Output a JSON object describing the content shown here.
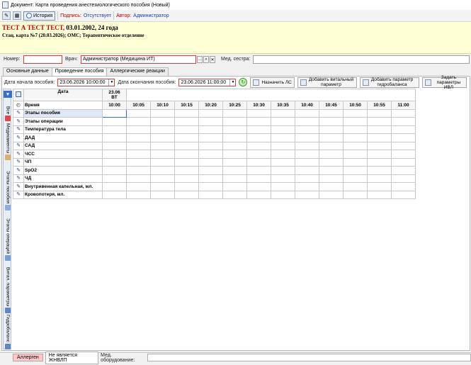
{
  "window": {
    "title": "Документ: Карта проведения анестезиологического пособия (Новый)"
  },
  "toolbar": {
    "history_label": "История",
    "signatures_label": "Подпись:",
    "signatures_value": "Отсутствует",
    "author_label": "Автор:",
    "author_value": "Администратор"
  },
  "patient": {
    "name": "ТЕСТ А ТЕСТ ТЕСТ,",
    "dob": "03.01.2002, 24 года",
    "card": "Стац. карта №7 (20.03.2026); ОМС; Терапевтическое отделение"
  },
  "staff": {
    "number_label": "Номер:",
    "number_value": "",
    "doctor_label": "Врач:",
    "doctor_value": "Администратор (Медицина ИТ)",
    "nurse_label": "Мед. сестра:",
    "nurse_value": ""
  },
  "tabs": [
    {
      "label": "Основные данные"
    },
    {
      "label": "Проведение пособия"
    },
    {
      "label": "Аллергические реакции"
    }
  ],
  "dates": {
    "start_label": "Дата начала пособия:",
    "start_value": "23.06.2026 10:00:00",
    "end_label": "Дата окончания пособия:",
    "end_value": "23.06.2026 11:00:00"
  },
  "actions": {
    "assign_ls": "Назначить ЛС",
    "add_vital_1": "Добавить витальный",
    "add_vital_2": "параметр",
    "add_hydro_1": "Добавить параметр",
    "add_hydro_2": "гидробаланса",
    "ivl_1": "Задать",
    "ivl_2": "параметры ИВЛ"
  },
  "sidebar": [
    {
      "label": "Все"
    },
    {
      "label": "Медикаменты"
    },
    {
      "label": "Этапы пособия"
    },
    {
      "label": "Этапы операций"
    },
    {
      "label": "Витал. параметры"
    },
    {
      "label": "Гидробаланс"
    }
  ],
  "grid": {
    "date_header": "Дата",
    "day_date": "23.06",
    "day_week": "ВТ",
    "time_label": "Время",
    "times": [
      "10:00",
      "10:05",
      "10:10",
      "10:15",
      "10:20",
      "10:25",
      "10:30",
      "10:35",
      "10:40",
      "10:45",
      "10:50",
      "10:55",
      "11:00"
    ],
    "rows": [
      "Этапы пособия",
      "Этапы операции",
      "Температура тела",
      "ДАД",
      "САД",
      "ЧСС",
      "ЧП",
      "SpO2",
      "ЧД",
      "Внутривенная капельная, мл.",
      "Кровопотеря, мл."
    ]
  },
  "status": {
    "allergen": "Аллерген",
    "jnvlp": "Не является ЖНВЛП",
    "med_equipment_label": "Мед. оборудование:"
  }
}
